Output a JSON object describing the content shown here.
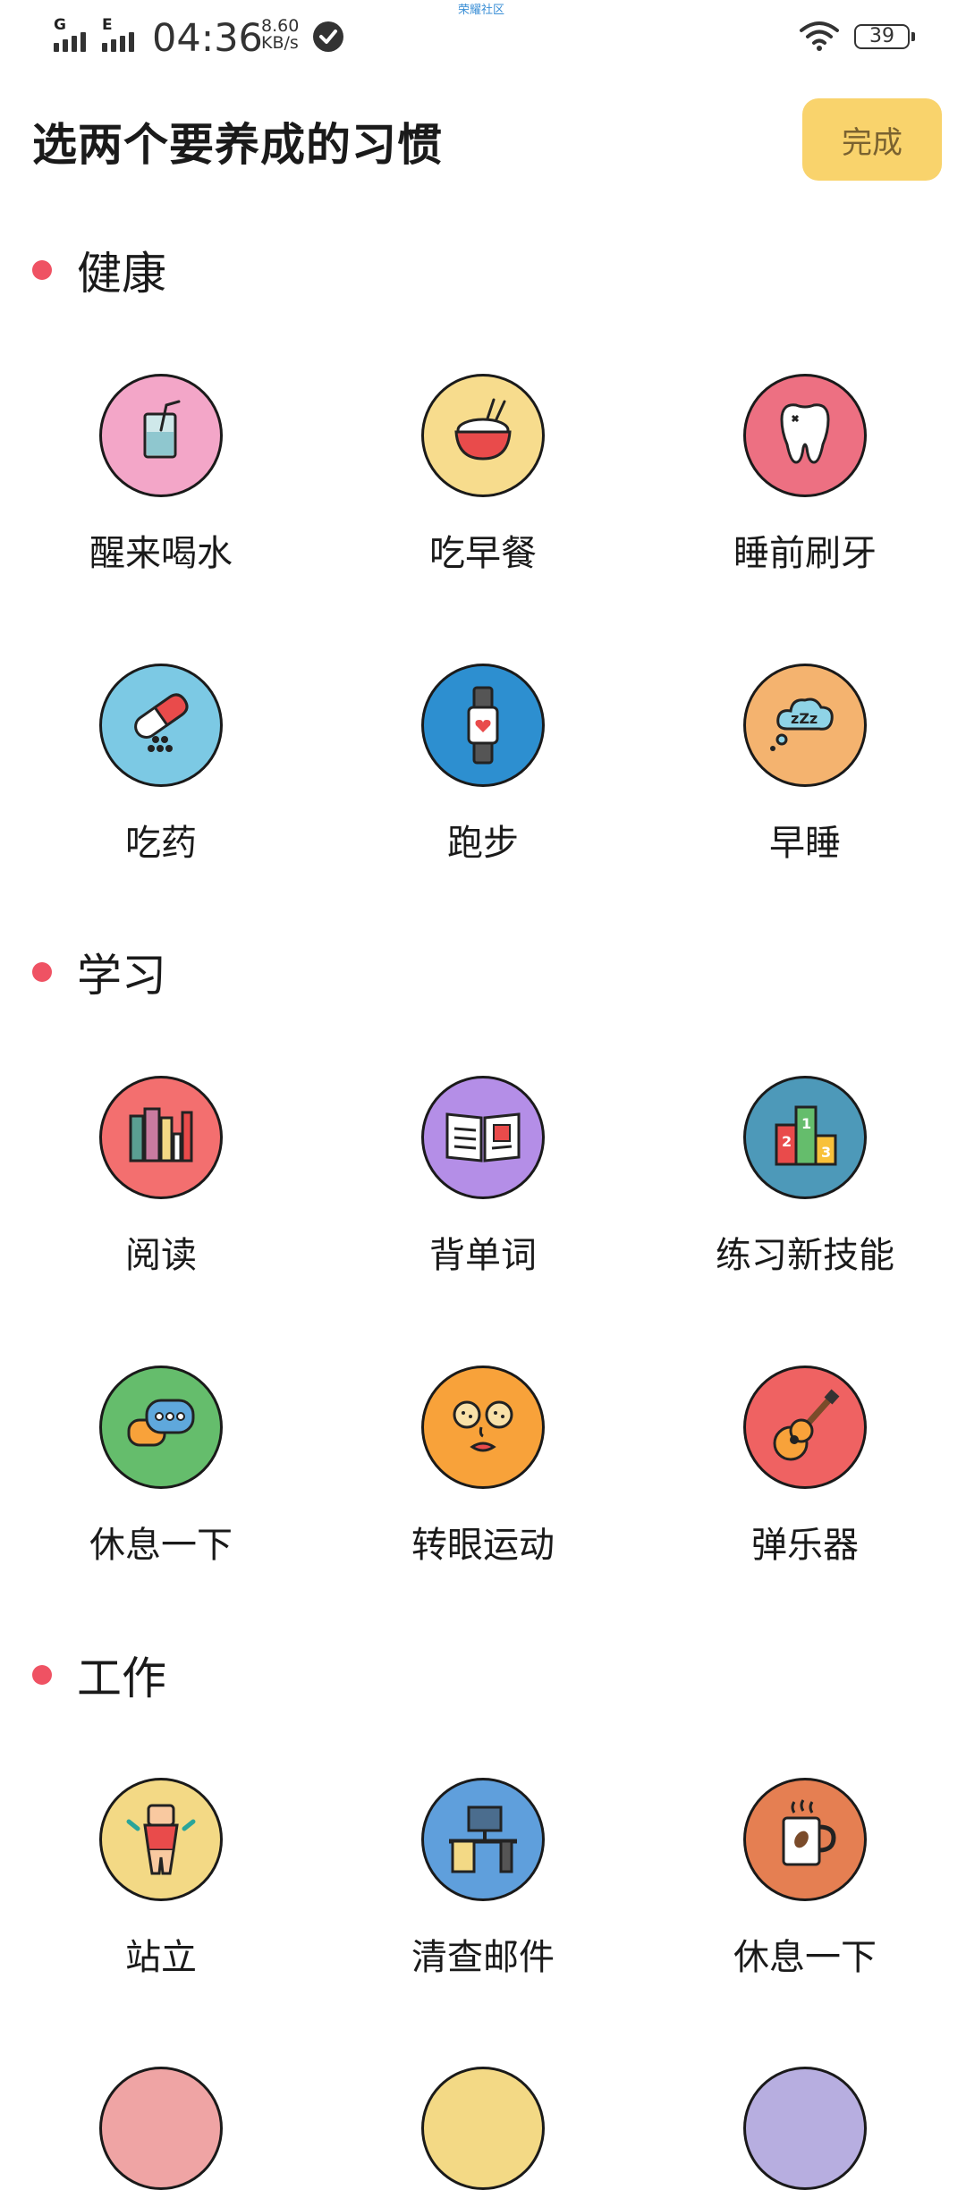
{
  "status_bar": {
    "signal1": "G",
    "signal2": "E",
    "time": "04:36",
    "speed_value": "8.60",
    "speed_unit": "KB/s",
    "carrier_text": "荣耀社区",
    "battery": "39"
  },
  "header": {
    "title": "选两个要养成的习惯",
    "done_label": "完成",
    "done_color": "#f9d36c"
  },
  "accent_color": "#ef5263",
  "sections": [
    {
      "title": "健康",
      "items": [
        {
          "label": "醒来喝水",
          "icon": "water-cup-icon",
          "color": "#f3a6c8"
        },
        {
          "label": "吃早餐",
          "icon": "rice-bowl-icon",
          "color": "#f7dc8d"
        },
        {
          "label": "睡前刷牙",
          "icon": "tooth-icon",
          "color": "#ed7082"
        },
        {
          "label": "吃药",
          "icon": "pill-icon",
          "color": "#7cc9e4"
        },
        {
          "label": "跑步",
          "icon": "smartwatch-icon",
          "color": "#2d8fd0"
        },
        {
          "label": "早睡",
          "icon": "sleep-cloud-icon",
          "color": "#f4b36f"
        }
      ]
    },
    {
      "title": "学习",
      "items": [
        {
          "label": "阅读",
          "icon": "books-icon",
          "color": "#f36f6f"
        },
        {
          "label": "背单词",
          "icon": "open-book-icon",
          "color": "#b48ee7"
        },
        {
          "label": "练习新技能",
          "icon": "podium-icon",
          "color": "#4d99b9"
        },
        {
          "label": "休息一下",
          "icon": "chat-bubbles-icon",
          "color": "#65bd6c"
        },
        {
          "label": "转眼运动",
          "icon": "face-mask-icon",
          "color": "#f8a23a"
        },
        {
          "label": "弹乐器",
          "icon": "guitar-icon",
          "color": "#ef6262"
        }
      ]
    },
    {
      "title": "工作",
      "items": [
        {
          "label": "站立",
          "icon": "standing-figure-icon",
          "color": "#f3d985"
        },
        {
          "label": "清查邮件",
          "icon": "computer-desk-icon",
          "color": "#5f9fdc"
        },
        {
          "label": "休息一下",
          "icon": "coffee-mug-icon",
          "color": "#e57f52"
        }
      ]
    }
  ]
}
